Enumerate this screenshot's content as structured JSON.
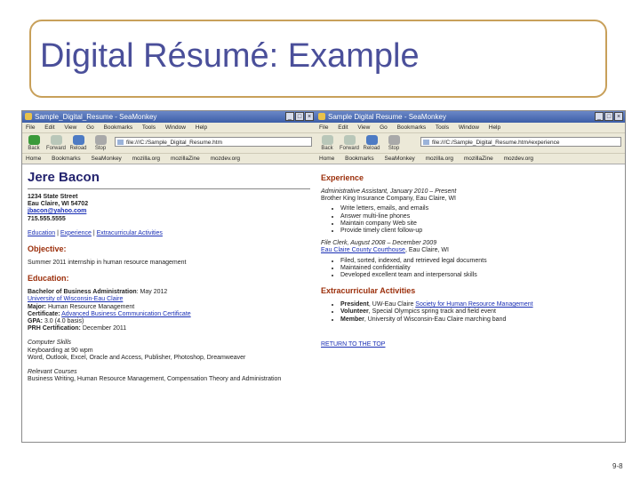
{
  "slide": {
    "title": "Digital Résumé: Example",
    "page_number": "9-8"
  },
  "browser": {
    "left_window_title": "Sample_Digital_Resume - SeaMonkey",
    "right_window_title": "Sample Digital Resume - SeaMonkey",
    "menu": [
      "File",
      "Edit",
      "View",
      "Go",
      "Bookmarks",
      "Tools",
      "Window",
      "Help"
    ],
    "nav": [
      "Back",
      "Forward",
      "Reload",
      "Stop"
    ],
    "left_url": "file:///C:/Sample_Digital_Resume.htm",
    "right_url": "file:///C:/Sample_Digital_Resume.htm#experience",
    "bookmarks": [
      "Home",
      "Bookmarks",
      "SeaMonkey",
      "mozilla.org",
      "mozillaZine",
      "mozdev.org"
    ]
  },
  "resume": {
    "name": "Jere Bacon",
    "address1": "1234 State Street",
    "address2": "Eau Claire, WI 54702",
    "email": "jbacon@yahoo.com",
    "phone": "715.555.5555",
    "nav_links": [
      "Education",
      "Experience",
      "Extracurricular Activities"
    ],
    "objective_heading": "Objective:",
    "objective_text": "Summer 2011 internship in human resource management",
    "education_heading": "Education:",
    "degree_label": "Bachelor of Business Administration",
    "degree_date": ": May 2012",
    "university": "University of Wisconsin-Eau Claire",
    "major_label": "Major:",
    "major_value": "Human Resource Management",
    "certificate_label": "Certificate:",
    "certificate_value": "Advanced Business Communication Certificate",
    "gpa_label": "GPA:",
    "gpa_value": "3.0 (4.0 basis)",
    "phr_label": "PRH Certification:",
    "phr_value": "December 2011",
    "skills_heading": "Computer Skills",
    "skills_1": "Keyboarding at 90 wpm",
    "skills_2": "Word, Outlook, Excel, Oracle and Access, Publisher, Photoshop, Dreamweaver",
    "courses_heading": "Relevant Courses",
    "courses_text": "Business Writing, Human Resource Management, Compensation Theory and Administration",
    "experience_heading": "Experience",
    "job1_title_dates": "Administrative Assistant, January 2010 – Present",
    "job1_company": "Brother King Insurance Company, Eau Claire, WI",
    "job1_duties": [
      "Write letters, emails, and emails",
      "Answer multi-line phones",
      "Maintain company Web site",
      "Provide timely client follow-up"
    ],
    "job2_title_dates": "File Clerk, August 2008 – December 2009",
    "job2_company": "Eau Claire County Courthouse",
    "job2_location": ", Eau Claire, WI",
    "job2_duties": [
      "Filed, sorted, indexed, and retrieved legal documents",
      "Maintained confidentiality",
      "Developed excellent team and interpersonal skills"
    ],
    "extracurricular_heading": "Extracurricular Activities",
    "activities": [
      {
        "label": "President",
        "text": ", UW-Eau Claire ",
        "link": "Society for Human Resource Management"
      },
      {
        "label": "Volunteer",
        "text": ", Special Olympics spring track and field event",
        "link": ""
      },
      {
        "label": "Member",
        "text": ", University of Wisconsin-Eau Claire marching band",
        "link": ""
      }
    ],
    "return_link": "RETURN TO THE TOP"
  }
}
